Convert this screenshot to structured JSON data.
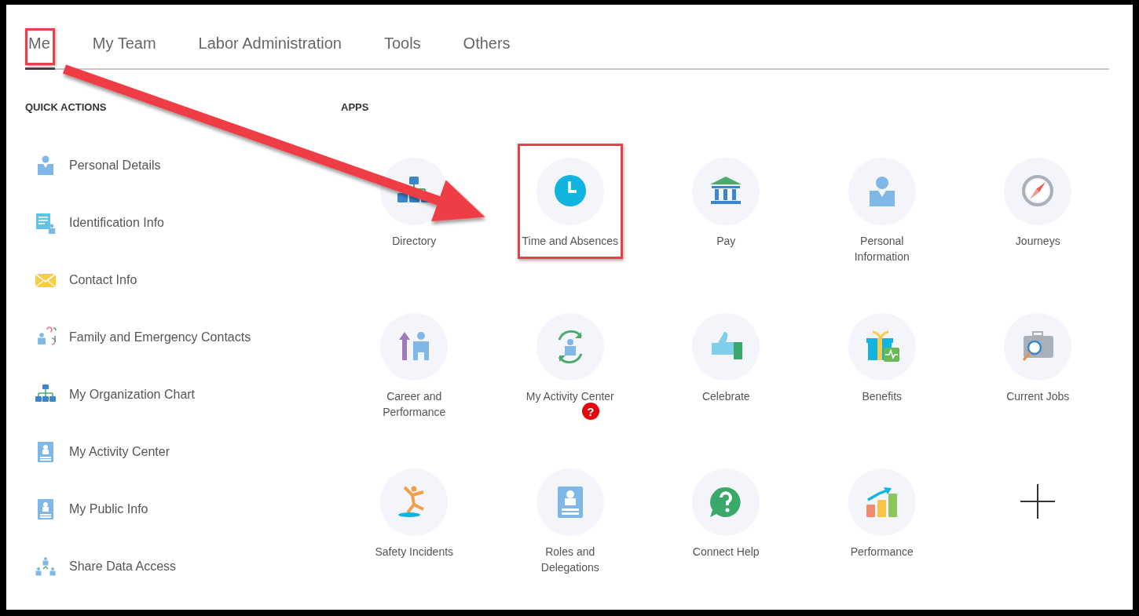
{
  "tabs": [
    {
      "label": "Me",
      "selected": true,
      "highlighted": true
    },
    {
      "label": "My Team",
      "selected": false,
      "highlighted": false
    },
    {
      "label": "Labor Administration",
      "selected": false,
      "highlighted": false
    },
    {
      "label": "Tools",
      "selected": false,
      "highlighted": false
    },
    {
      "label": "Others",
      "selected": false,
      "highlighted": false
    }
  ],
  "quick_actions": {
    "heading": "QUICK ACTIONS",
    "items": [
      {
        "label": "Personal Details"
      },
      {
        "label": "Identification Info"
      },
      {
        "label": "Contact Info"
      },
      {
        "label": "Family and Emergency Contacts"
      },
      {
        "label": "My Organization Chart"
      },
      {
        "label": "My Activity Center"
      },
      {
        "label": "My Public Info"
      },
      {
        "label": "Share Data Access"
      }
    ]
  },
  "apps": {
    "heading": "APPS",
    "items": [
      {
        "kind": "app",
        "label": "Directory",
        "highlighted": false
      },
      {
        "kind": "app",
        "label": "Time and Absences",
        "highlighted": true
      },
      {
        "kind": "app",
        "label": "Pay",
        "highlighted": false
      },
      {
        "kind": "app",
        "label": "Personal Information",
        "highlighted": false
      },
      {
        "kind": "app",
        "label": "Journeys",
        "highlighted": false
      },
      {
        "kind": "app",
        "label": "Career and Performance",
        "highlighted": false
      },
      {
        "kind": "app",
        "label": "My Activity Center",
        "highlighted": false,
        "badge": "?"
      },
      {
        "kind": "app",
        "label": "Celebrate",
        "highlighted": false
      },
      {
        "kind": "app",
        "label": "Benefits",
        "highlighted": false
      },
      {
        "kind": "app",
        "label": "Current Jobs",
        "highlighted": false
      },
      {
        "kind": "app",
        "label": "Safety Incidents",
        "highlighted": false
      },
      {
        "kind": "app",
        "label": "Roles and Delegations",
        "highlighted": false
      },
      {
        "kind": "app",
        "label": "Connect Help",
        "highlighted": false
      },
      {
        "kind": "app",
        "label": "Performance",
        "highlighted": false
      },
      {
        "kind": "add"
      }
    ]
  }
}
